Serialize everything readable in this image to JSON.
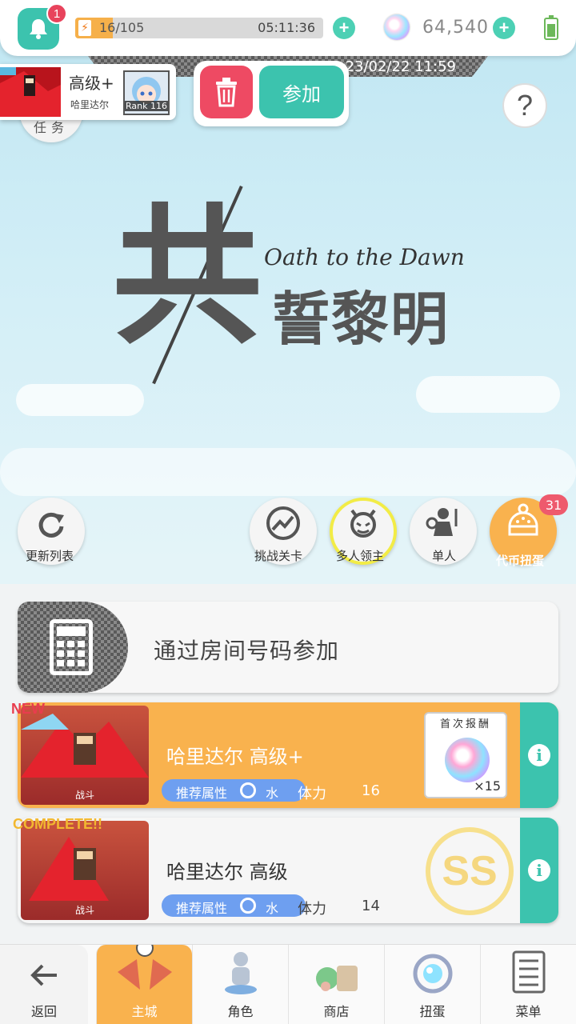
{
  "top_bar": {
    "notification_count": "1",
    "stamina": "16/105",
    "stamina_timer": "05:11:36",
    "gem_count": "64,540",
    "stamina_fraction": 0.15
  },
  "event_ribbon": {
    "text": "23/02/22 11:59"
  },
  "recruit": {
    "title": "高级+",
    "host": "哈里达尔",
    "rank": "Rank 116",
    "join_label": "参加"
  },
  "mission_label": "任务",
  "logo": {
    "big_char": "共",
    "chars": "誓黎明",
    "english": "Oath to the Dawn"
  },
  "round_buttons": {
    "refresh": "更新列表",
    "challenge": "挑战关卡",
    "multi_boss": "多人领主",
    "solo": "单人",
    "token_gacha": "代币扭蛋",
    "token_badge": "31"
  },
  "room_join": {
    "label": "通过房间号码参加"
  },
  "quests": [
    {
      "tag": "NEW",
      "title": "哈里达尔 高级+",
      "attr_label": "推荐属性",
      "attr": "水",
      "stamina_label": "体力",
      "stamina": "16",
      "battle": "战斗",
      "reward_label": "首次报酬",
      "reward_qty": "×15"
    },
    {
      "tag": "COMPLETE!!",
      "title": "哈里达尔 高级",
      "attr_label": "推荐属性",
      "attr": "水",
      "stamina_label": "体力",
      "stamina": "14",
      "battle": "战斗",
      "rank": "SS"
    }
  ],
  "bottom_nav": {
    "back": "返回",
    "home": "主城",
    "character": "角色",
    "shop": "商店",
    "gacha": "扭蛋",
    "menu": "菜单"
  },
  "colors": {
    "teal": "#3cc3ae",
    "orange": "#f9b24e",
    "red": "#ee4a63",
    "attr_blue": "#6e9ff0"
  }
}
